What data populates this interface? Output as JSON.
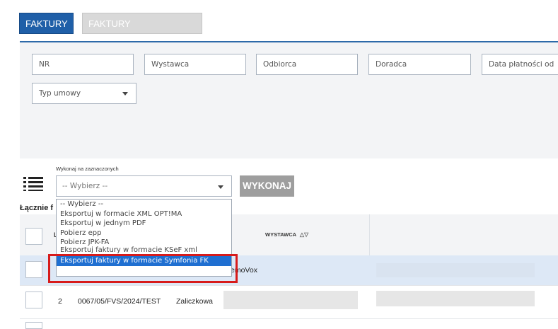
{
  "tabs": [
    {
      "label": "FAKTURY",
      "active": true
    },
    {
      "label": "FAKTURY KORYGUJĄCE",
      "active": false
    }
  ],
  "filters": {
    "nr_placeholder": "NR",
    "wystawca_placeholder": "Wystawca",
    "odbiorca_placeholder": "Odbiorca",
    "doradca_placeholder": "Doradca",
    "data_platnosci_placeholder": "Data płatności od",
    "typ_umowy_placeholder": "Typ umowy"
  },
  "bulk_action": {
    "label": "Wykonaj na zaznaczonych",
    "select_value": "-- Wybierz --",
    "execute_label": "WYKONAJ",
    "options": [
      "-- Wybierz --",
      "Eksportuj w formacie XML OPT!MA",
      "Eksportuj w jednym PDF",
      "Pobierz epp",
      "Pobierz JPK-FA",
      "Eksportuj faktury w formacie KSeF xml",
      "Eksportuj faktury w formacie Symfonia FK"
    ],
    "highlighted_option_index": 6
  },
  "total_label": "Łącznie f",
  "table": {
    "columns": {
      "lp_fragment": "L",
      "wystawca": "WYSTAWCA"
    },
    "sort_icons": "△▽",
    "rows": [
      {
        "tail_text": "emoVox"
      },
      {
        "lp": "2",
        "nr": "0067/05/FVS/2024/TEST",
        "typ": "Zaliczkowa"
      }
    ]
  },
  "colors": {
    "primary": "#1f5fa8",
    "highlight": "#1f6fd1",
    "annotation": "#d71b1b",
    "row_selected": "#dde8f6"
  }
}
